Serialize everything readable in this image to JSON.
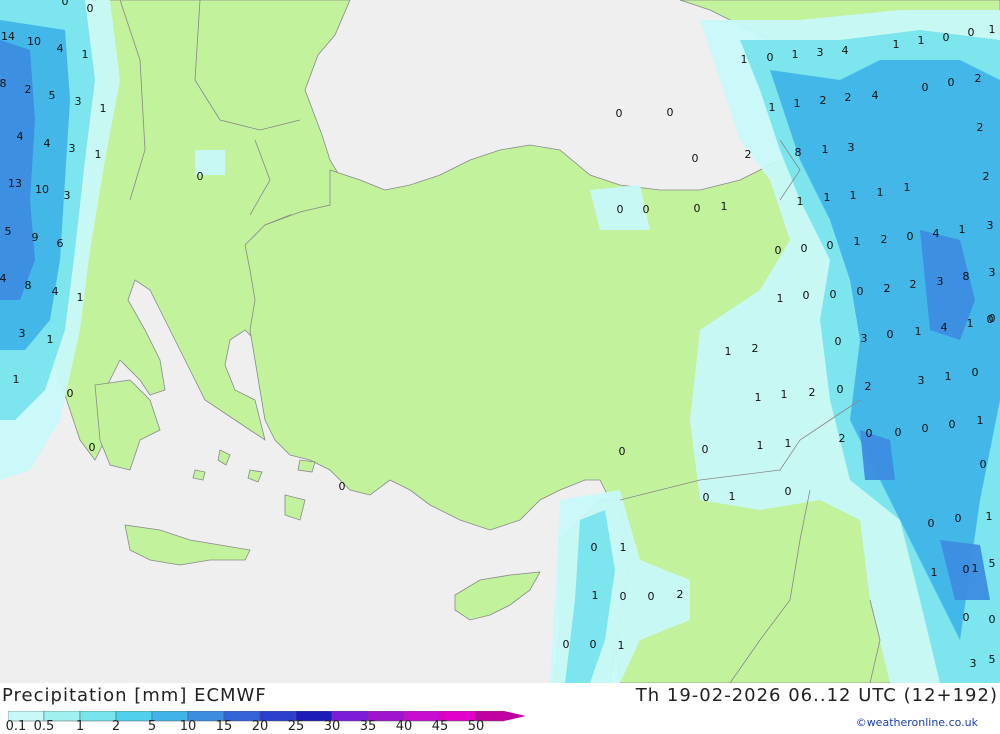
{
  "header": {
    "title": "Precipitation [mm] ECMWF",
    "valid_time": "Th 19-02-2026 06..12 UTC (12+192)",
    "credit": "©weatheronline.co.uk"
  },
  "legend": {
    "labels": [
      "0.1",
      "0.5",
      "1",
      "2",
      "5",
      "10",
      "15",
      "20",
      "25",
      "30",
      "35",
      "40",
      "45",
      "50"
    ],
    "colors": [
      "#c8f8f8",
      "#a0f0f0",
      "#78e4ec",
      "#50d0ec",
      "#40b4e8",
      "#3c8ce0",
      "#3464d8",
      "#2c40cc",
      "#1c1cb8",
      "#7c1cd8",
      "#a014d0",
      "#c80cd0",
      "#e000c8",
      "#c000a0"
    ]
  },
  "colors": {
    "sea": "#efefef",
    "land": "#c2f29c",
    "precip_light": "#c8f8f8",
    "precip_mid": "#78e4ec",
    "precip_heavy": "#40b4e8",
    "precip_strong": "#3c8ce0"
  },
  "map_values": [
    {
      "v": "14"
    },
    {
      "v": "10"
    },
    {
      "v": "4"
    },
    {
      "v": "1"
    },
    {
      "v": "0"
    },
    {
      "v": "0"
    },
    {
      "v": "8"
    },
    {
      "v": "2"
    },
    {
      "v": "5"
    },
    {
      "v": "3"
    },
    {
      "v": "1"
    },
    {
      "v": "4"
    },
    {
      "v": "4"
    },
    {
      "v": "3"
    },
    {
      "v": "1"
    },
    {
      "v": "13"
    },
    {
      "v": "10"
    },
    {
      "v": "3"
    },
    {
      "v": "5"
    },
    {
      "v": "9"
    },
    {
      "v": "6"
    },
    {
      "v": "4"
    },
    {
      "v": "8"
    },
    {
      "v": "4"
    },
    {
      "v": "1"
    },
    {
      "v": "3"
    },
    {
      "v": "1"
    },
    {
      "v": "1"
    },
    {
      "v": "0"
    },
    {
      "v": "0"
    },
    {
      "v": "0"
    },
    {
      "v": "0"
    },
    {
      "v": "0"
    },
    {
      "v": "0"
    },
    {
      "v": "0"
    },
    {
      "v": "0"
    },
    {
      "v": "0"
    },
    {
      "v": "1"
    },
    {
      "v": "2"
    },
    {
      "v": "8"
    },
    {
      "v": "1"
    },
    {
      "v": "3"
    },
    {
      "v": "1"
    },
    {
      "v": "1"
    },
    {
      "v": "2"
    },
    {
      "v": "2"
    },
    {
      "v": "4"
    },
    {
      "v": "1"
    },
    {
      "v": "0"
    },
    {
      "v": "1"
    },
    {
      "v": "3"
    },
    {
      "v": "4"
    },
    {
      "v": "1"
    },
    {
      "v": "1"
    },
    {
      "v": "0"
    },
    {
      "v": "0"
    },
    {
      "v": "1"
    },
    {
      "v": "2"
    },
    {
      "v": "0"
    },
    {
      "v": "0"
    },
    {
      "v": "2"
    },
    {
      "v": "2"
    },
    {
      "v": "1"
    },
    {
      "v": "1"
    },
    {
      "v": "1"
    },
    {
      "v": "1"
    },
    {
      "v": "1"
    },
    {
      "v": "0"
    },
    {
      "v": "0"
    },
    {
      "v": "0"
    },
    {
      "v": "1"
    },
    {
      "v": "2"
    },
    {
      "v": "0"
    },
    {
      "v": "4"
    },
    {
      "v": "1"
    },
    {
      "v": "3"
    },
    {
      "v": "1"
    },
    {
      "v": "0"
    },
    {
      "v": "0"
    },
    {
      "v": "0"
    },
    {
      "v": "2"
    },
    {
      "v": "2"
    },
    {
      "v": "3"
    },
    {
      "v": "8"
    },
    {
      "v": "3"
    },
    {
      "v": "0"
    },
    {
      "v": "0"
    },
    {
      "v": "3"
    },
    {
      "v": "0"
    },
    {
      "v": "1"
    },
    {
      "v": "4"
    },
    {
      "v": "1"
    },
    {
      "v": "0"
    },
    {
      "v": "0"
    },
    {
      "v": "1"
    },
    {
      "v": "3"
    },
    {
      "v": "1"
    },
    {
      "v": "2"
    },
    {
      "v": "1"
    },
    {
      "v": "0"
    },
    {
      "v": "0"
    },
    {
      "v": "0"
    },
    {
      "v": "0"
    },
    {
      "v": "2"
    },
    {
      "v": "1"
    },
    {
      "v": "1"
    },
    {
      "v": "2"
    },
    {
      "v": "0"
    },
    {
      "v": "2"
    },
    {
      "v": "0"
    },
    {
      "v": "1"
    },
    {
      "v": "1"
    },
    {
      "v": "0"
    },
    {
      "v": "1"
    },
    {
      "v": "0"
    },
    {
      "v": "0"
    },
    {
      "v": "0"
    },
    {
      "v": "0"
    },
    {
      "v": "1"
    },
    {
      "v": "1"
    },
    {
      "v": "5"
    },
    {
      "v": "0"
    },
    {
      "v": "1"
    },
    {
      "v": "0"
    },
    {
      "v": "0"
    },
    {
      "v": "3"
    },
    {
      "v": "5"
    },
    {
      "v": "0"
    },
    {
      "v": "1"
    },
    {
      "v": "0"
    },
    {
      "v": "0"
    },
    {
      "v": "1"
    },
    {
      "v": "0"
    },
    {
      "v": "2"
    },
    {
      "v": "1"
    },
    {
      "v": "0"
    },
    {
      "v": "0"
    },
    {
      "v": "0"
    }
  ]
}
